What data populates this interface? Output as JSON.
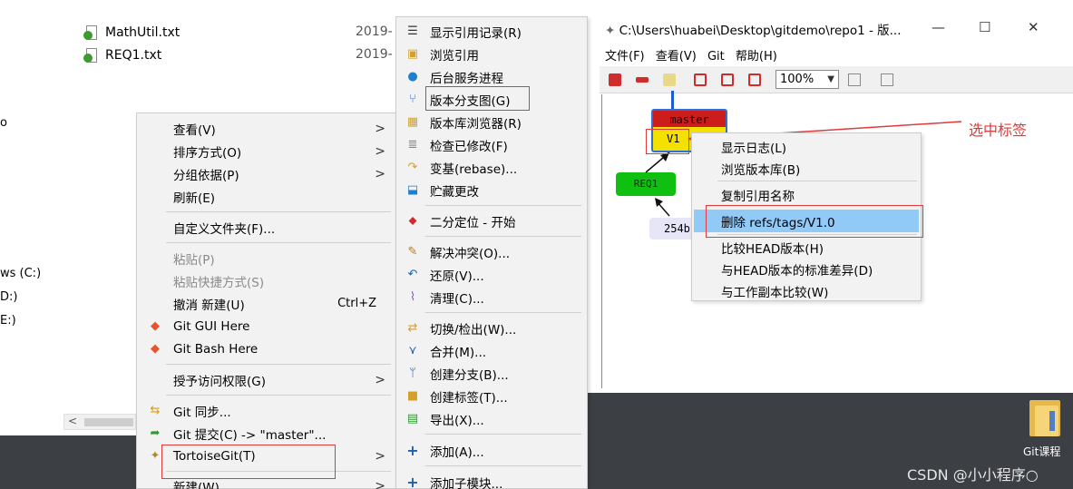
{
  "explorer": {
    "files": [
      {
        "name": "MathUtil.txt",
        "date": "2019-"
      },
      {
        "name": "REQ1.txt",
        "date": "2019-"
      }
    ],
    "drives": [
      "ws (C:)",
      "D:)",
      "E:)"
    ],
    "side_char": "o",
    "scroll_arrow": "<"
  },
  "context_menu": {
    "items": [
      {
        "label": "查看(V)",
        "submenu": true
      },
      {
        "label": "排序方式(O)",
        "submenu": true
      },
      {
        "label": "分组依据(P)",
        "submenu": true
      },
      {
        "label": "刷新(E)"
      },
      {
        "label": "自定义文件夹(F)..."
      },
      {
        "label": "粘贴(P)",
        "disabled": true
      },
      {
        "label": "粘贴快捷方式(S)",
        "disabled": true
      },
      {
        "label": "撤消 新建(U)",
        "shortcut": "Ctrl+Z"
      },
      {
        "label": "Git GUI Here"
      },
      {
        "label": "Git Bash Here"
      },
      {
        "label": "授予访问权限(G)",
        "submenu": true
      },
      {
        "label": "Git 同步..."
      },
      {
        "label": "Git 提交(C) -> \"master\"..."
      },
      {
        "label": "TortoiseGit(T)",
        "submenu": true
      },
      {
        "label": "新建(W)",
        "submenu": true
      }
    ],
    "arrow": ">"
  },
  "tortoise_menu": {
    "items": [
      {
        "label": "显示引用记录(R)"
      },
      {
        "label": "浏览引用"
      },
      {
        "label": "后台服务进程"
      },
      {
        "label": "版本分支图(G)"
      },
      {
        "label": "版本库浏览器(R)"
      },
      {
        "label": "检查已修改(F)"
      },
      {
        "label": "变基(rebase)..."
      },
      {
        "label": "贮藏更改"
      },
      {
        "label": "二分定位 - 开始"
      },
      {
        "label": "解决冲突(O)..."
      },
      {
        "label": "还原(V)..."
      },
      {
        "label": "清理(C)..."
      },
      {
        "label": "切换/检出(W)..."
      },
      {
        "label": "合并(M)..."
      },
      {
        "label": "创建分支(B)..."
      },
      {
        "label": "创建标签(T)..."
      },
      {
        "label": "导出(X)..."
      },
      {
        "label": "添加(A)..."
      },
      {
        "label": "添加子模块..."
      }
    ]
  },
  "window": {
    "title": "C:\\Users\\huabei\\Desktop\\gitdemo\\repo1 - 版...",
    "menubar": [
      "文件(F)",
      "查看(V)",
      "Git",
      "帮助(H)"
    ],
    "zoom": "100%",
    "controls": {
      "minimize": "—",
      "maximize": "☐",
      "close": "✕"
    }
  },
  "graph": {
    "master_label": "master",
    "tag_label": "V1",
    "branch_label": "REQ1",
    "hash_label": "254b"
  },
  "tag_menu": {
    "items": [
      {
        "label": "显示日志(L)"
      },
      {
        "label": "浏览版本库(B)"
      },
      {
        "label": "复制引用名称"
      },
      {
        "label": "删除 refs/tags/V1.0",
        "selected": true
      },
      {
        "label": "比较HEAD版本(H)"
      },
      {
        "label": "与HEAD版本的标准差异(D)"
      },
      {
        "label": "与工作副本比较(W)"
      }
    ]
  },
  "annotation": "选中标签",
  "desktop": {
    "folder_label": "Git课程",
    "watermark": "CSDN @小小程序○"
  },
  "colors": {
    "highlight_red": "#e03a3a",
    "selected_blue": "#91c9f7",
    "master_red": "#cc1c1c",
    "tag_yellow": "#f5e100",
    "branch_green": "#10c010"
  }
}
